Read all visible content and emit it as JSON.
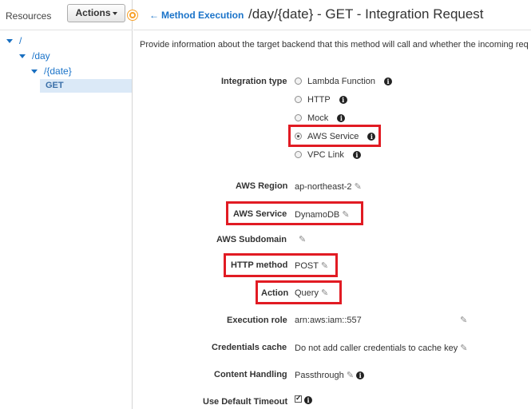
{
  "sidebar": {
    "title": "Resources",
    "actions_label": "Actions",
    "tree": [
      {
        "label": "/"
      },
      {
        "label": "/day"
      },
      {
        "label": "/{date}"
      },
      {
        "label": "GET"
      }
    ]
  },
  "header": {
    "back_label": "Method Execution",
    "title": "/day/{date} - GET - Integration Request"
  },
  "description": "Provide information about the target backend that this method will call and whether the incoming req",
  "integration_type": {
    "label": "Integration type",
    "options": [
      {
        "label": "Lambda Function",
        "selected": false
      },
      {
        "label": "HTTP",
        "selected": false
      },
      {
        "label": "Mock",
        "selected": false
      },
      {
        "label": "AWS Service",
        "selected": true
      },
      {
        "label": "VPC Link",
        "selected": false
      }
    ]
  },
  "fields": {
    "aws_region": {
      "label": "AWS Region",
      "value": "ap-northeast-2"
    },
    "aws_service": {
      "label": "AWS Service",
      "value": "DynamoDB"
    },
    "aws_subdomain": {
      "label": "AWS Subdomain",
      "value": ""
    },
    "http_method": {
      "label": "HTTP method",
      "value": "POST"
    },
    "action": {
      "label": "Action",
      "value": "Query"
    },
    "execution_role": {
      "label": "Execution role",
      "value": "arn:aws:iam::557"
    },
    "credentials_cache": {
      "label": "Credentials cache",
      "value": "Do not add caller credentials to cache key"
    },
    "content_handling": {
      "label": "Content Handling",
      "value": "Passthrough"
    },
    "default_timeout": {
      "label": "Use Default Timeout",
      "checked": true
    }
  },
  "colors": {
    "accent": "#1a73c9",
    "highlight": "#e11b23",
    "selected_bg": "#dbe9f7"
  },
  "icons": {
    "back": "left-arrow-icon",
    "info": "info-icon",
    "edit": "pencil-icon"
  }
}
